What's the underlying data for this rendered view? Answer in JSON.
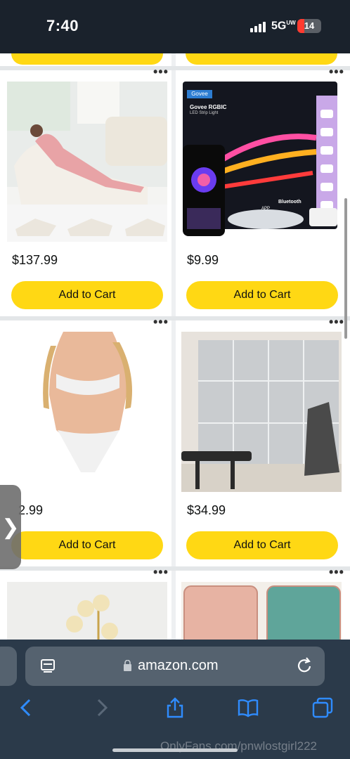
{
  "status": {
    "time": "7:40",
    "network": "5G",
    "network_sup": "UW",
    "battery": "14"
  },
  "products": [
    {
      "price": "$137.99",
      "cart_label": "Add to Cart",
      "more": "•••"
    },
    {
      "price": "$9.99",
      "cart_label": "Add to Cart",
      "more": "•••"
    },
    {
      "price": "2.99",
      "cart_label": "Add to Cart",
      "more": "•••"
    },
    {
      "price": "$34.99",
      "cart_label": "Add to Cart",
      "more": "•••"
    },
    {
      "more": "•••"
    },
    {
      "more": "•••"
    }
  ],
  "box_art": {
    "brand": "Govee",
    "title": "Govee RGBIC",
    "subtitle": "LED Strip Light",
    "app_label": "APP",
    "bluetooth_label": "Bluetooth"
  },
  "side_tab": "❯",
  "browser": {
    "url": "amazon.com"
  },
  "watermark": "OnlyFans.com/pnwlostgirl222",
  "colors": {
    "accent": "#ffd814",
    "chrome": "#2b3a4a",
    "link_blue": "#2f8cff"
  }
}
